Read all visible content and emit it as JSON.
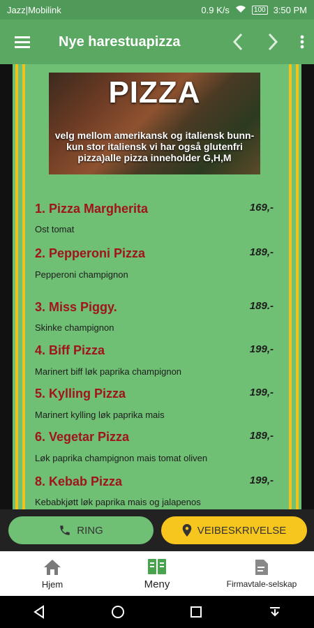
{
  "status": {
    "carrier": "Jazz|Mobilink",
    "network": "0.9 K/s",
    "battery": "100",
    "time": "3:50 PM"
  },
  "appbar": {
    "title": "Nye harestuapizza"
  },
  "banner": {
    "heading": "PIZZA",
    "description": "velg mellom amerikansk og italiensk bunn- kun stor italiensk vi har også glutenfri pizza)alle pizza inneholder G,H,M"
  },
  "menu_items": [
    {
      "name": "1. Pizza Margherita",
      "price": "169,-",
      "desc": "Ost tomat"
    },
    {
      "name": "2. Pepperoni Pizza",
      "price": "189,-",
      "desc": "Pepperoni champignon"
    },
    {
      "name": "3. Miss Piggy.",
      "price": "189.-",
      "desc": "Skinke champignon"
    },
    {
      "name": "4. Biff Pizza",
      "price": "199,-",
      "desc": "Marinert biff løk paprika champignon"
    },
    {
      "name": "5. Kylling Pizza",
      "price": "199,-",
      "desc": "Marinert kylling løk paprika mais"
    },
    {
      "name": "6. Vegetar Pizza",
      "price": "189,-",
      "desc": "Løk paprika champignon mais tomat oliven"
    },
    {
      "name": "8. Kebab Pizza",
      "price": "199,-",
      "desc": "Kebabkjøtt løk paprika mais og jalapenos"
    }
  ],
  "actions": {
    "ring": "RING",
    "veibeskrivelse": "VEIBESKRIVELSE"
  },
  "tabs": [
    {
      "label": "Hjem",
      "icon": "home-icon"
    },
    {
      "label": "Meny",
      "icon": "menu-book-icon"
    },
    {
      "label": "Firmavtale-selskap",
      "icon": "document-icon"
    }
  ],
  "colors": {
    "appbar": "#5aa862",
    "panel": "#6fbf74",
    "accent": "#f6c51e",
    "item_name": "#a0141c"
  }
}
